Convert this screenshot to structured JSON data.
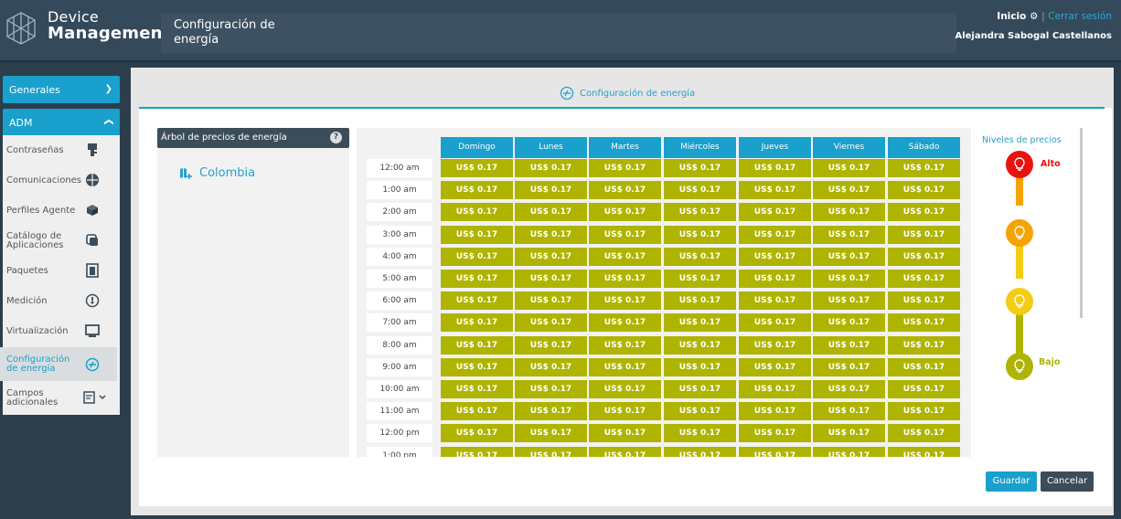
{
  "app": {
    "brand_line1": "Device",
    "brand_line2": "Management"
  },
  "header": {
    "page_title": "Configuración de energía",
    "home_label": "Inicio",
    "separator": "|",
    "logout_label": "Cerrar sesión",
    "user_name": "Alejandra Sabogal Castellanos"
  },
  "sidebar": {
    "generales_label": "Generales",
    "adm_label": "ADM",
    "items": [
      {
        "label": "Contraseñas",
        "icon": "key-icon"
      },
      {
        "label": "Comunicaciones",
        "icon": "network-icon"
      },
      {
        "label": "Perfiles Agente",
        "icon": "cube-icon"
      },
      {
        "label": "Catálogo de Aplicaciones",
        "icon": "app-catalog-icon"
      },
      {
        "label": "Paquetes",
        "icon": "package-icon"
      },
      {
        "label": "Medición",
        "icon": "gauge-icon"
      },
      {
        "label": "Virtualización",
        "icon": "monitor-icon"
      },
      {
        "label": "Configuración de energía",
        "icon": "energy-icon"
      },
      {
        "label": "Campos adicionales",
        "icon": "add-field-icon"
      }
    ]
  },
  "content": {
    "tab_title": "Configuración de energía",
    "tree": {
      "title": "Árbol de precios de energía",
      "help": "?",
      "item": "Colombia"
    },
    "days": [
      "Domingo",
      "Lunes",
      "Martes",
      "Miércoles",
      "Jueves",
      "Viernes",
      "Sábado"
    ],
    "hours": [
      "12:00 am",
      "1:00 am",
      "2:00 am",
      "3:00 am",
      "4:00 am",
      "5:00 am",
      "6:00 am",
      "7:00 am",
      "8:00 am",
      "9:00 am",
      "10:00 am",
      "11:00 am",
      "12:00 pm",
      "1:00 pm"
    ],
    "price": "US$ 0.17",
    "cell_color": "#aeb400",
    "legend": {
      "title": "Niveles de precios",
      "high": "Alto",
      "low": "Bajo",
      "colors": [
        "#e8120f",
        "#f5a300",
        "#f3cc14",
        "#aeb400"
      ]
    }
  },
  "actions": {
    "save": "Guardar",
    "cancel": "Cancelar"
  }
}
